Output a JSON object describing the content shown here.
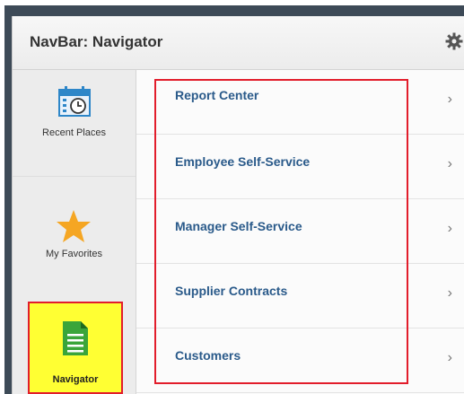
{
  "header": {
    "title": "NavBar: Navigator",
    "settings_icon": "gear-icon"
  },
  "sidebar": {
    "items": [
      {
        "label": "Recent Places",
        "icon": "calendar-clock-icon"
      },
      {
        "label": "My Favorites",
        "icon": "star-icon"
      },
      {
        "label": "Navigator",
        "icon": "document-icon",
        "selected": true
      }
    ]
  },
  "navigator": {
    "items": [
      {
        "label": "Report Center"
      },
      {
        "label": "Employee Self-Service"
      },
      {
        "label": "Manager Self-Service"
      },
      {
        "label": "Supplier Contracts"
      },
      {
        "label": "Customers"
      }
    ],
    "chevron": "›"
  },
  "colors": {
    "highlight": "#e21d2b",
    "selected_bg": "#ffff33",
    "link": "#2a5a8a",
    "star": "#f5a623",
    "doc": "#3aa53a",
    "calendar": "#2d86c8"
  }
}
